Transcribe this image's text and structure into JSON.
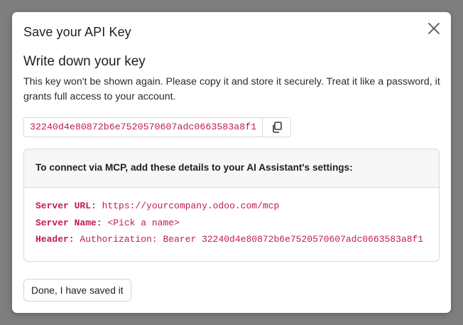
{
  "dialog": {
    "title": "Save your API Key",
    "close_icon": "close-icon"
  },
  "section": {
    "title": "Write down your key",
    "description": "This key won't be shown again. Please copy it and store it securely. Treat it like a password, it grants full access to your account."
  },
  "api_key": {
    "value": "32240d4e80872b6e7520570607adc0663583a8f1",
    "copy_icon": "copy-icon"
  },
  "mcp": {
    "header": "To connect via MCP, add these details to your AI Assistant's settings:",
    "server_url_label": "Server URL:",
    "server_url_value": "https://yourcompany.odoo.com/mcp",
    "server_name_label": "Server Name:",
    "server_name_value": "<Pick a name>",
    "header_label": "Header:",
    "header_value": "Authorization: Bearer 32240d4e80872b6e7520570607adc0663583a8f1"
  },
  "footer": {
    "done_label": "Done, I have saved it"
  },
  "colors": {
    "accent_code": "#c2185b",
    "overlay": "#7f7f7f"
  }
}
